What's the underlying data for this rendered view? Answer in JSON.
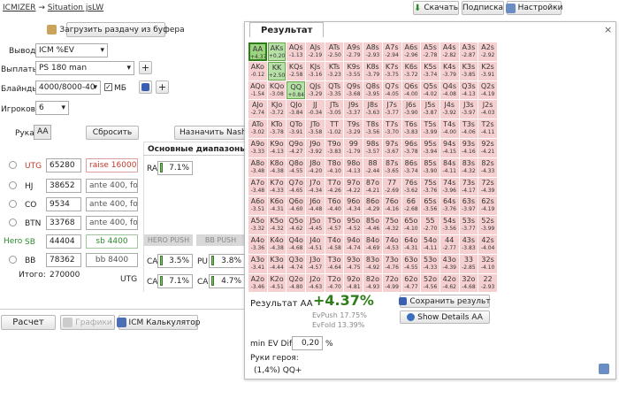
{
  "breadcrumb": {
    "root": "ICMIZER",
    "sep": "→",
    "current": "Situation jsLW"
  },
  "top_buttons": {
    "download": "Скачать",
    "subscribe": "Подписка",
    "settings": "Настройки"
  },
  "left": {
    "load_btn": "Загрузить раздачу из буфера",
    "output_label": "Вывод",
    "output_value": "ICM %EV",
    "payouts_label": "Выплаты",
    "payouts_value": "PS 180 man",
    "blinds_label": "Блайнды",
    "blinds_value": "4000/8000-40",
    "bb_check": "МБ",
    "players_label": "Игроков",
    "players_value": "6",
    "hand_label": "Рука",
    "hand_value": "AA",
    "reset_btn": "Сбросить",
    "assign_btn": "Назначить Nash д",
    "ranges_tab": "Основные диапазоны",
    "ra_label": "RA",
    "ra_value": "7.1%",
    "players": [
      {
        "pos": "UTG",
        "stack": "65280",
        "action": "raise 16000"
      },
      {
        "pos": "HJ",
        "stack": "38652",
        "action": "ante 400, fold"
      },
      {
        "pos": "CO",
        "stack": "9534",
        "action": "ante 400, fold"
      },
      {
        "pos": "BTN",
        "stack": "33768",
        "action": "ante 400, fold"
      },
      {
        "pos": "SB",
        "hero": "Hero",
        "stack": "44404",
        "action": "sb 4400"
      },
      {
        "pos": "BB",
        "stack": "78362",
        "action": "bb 8400"
      }
    ],
    "total_label": "Итого:",
    "total_value": "270000",
    "bottom_pos": "UTG",
    "hero_push": "HERO PUSH",
    "bb_push": "BB PUSH",
    "ca1_label": "CA",
    "ca1_value": "3.5%",
    "pu_label": "PU",
    "pu_value": "3.8%",
    "ca2_label": "CA",
    "ca2_value": "7.1%",
    "ca3_label": "CA",
    "ca3_value": "4.7%"
  },
  "bottom_buttons": {
    "calc": "Расчет",
    "graphs": "Графики",
    "icm": "ICM Калькулятор"
  },
  "result": {
    "tab": "Результат",
    "title": "Результат AA",
    "value": "+4.37%",
    "evpush": "EvPush 17.75%",
    "evfold": "EvFold 13.39%",
    "save_btn": "Сохранить результ",
    "details_btn": "Show Details AA",
    "minev_label": "min EV Diff",
    "minev_value": "0,20",
    "minev_unit": "%",
    "hero_hands_label": "Руки героя:",
    "hero_hands_value": "(1,4%) QQ+"
  },
  "colors": {
    "positive": "#b7e0a6",
    "negative": "#f6d0d0",
    "selected": "#9bd37f",
    "accent": "#2e7d1a"
  },
  "grid": [
    [
      [
        "AA",
        "+4.37",
        "sel"
      ],
      [
        "AKs",
        "+0.20",
        "pos"
      ],
      [
        "AQs",
        "-1.13"
      ],
      [
        "AJs",
        "-2.19"
      ],
      [
        "ATs",
        "-2.50"
      ],
      [
        "A9s",
        "-2.79"
      ],
      [
        "A8s",
        "-2.93"
      ],
      [
        "A7s",
        "-2.94"
      ],
      [
        "A6s",
        "-2.96"
      ],
      [
        "A5s",
        "-2.78"
      ],
      [
        "A4s",
        "-2.82"
      ],
      [
        "A3s",
        "-2.87"
      ],
      [
        "A2s",
        "-2.92"
      ]
    ],
    [
      [
        "AKo",
        "-0.12"
      ],
      [
        "KK",
        "+2.50",
        "pos"
      ],
      [
        "KQs",
        "-2.58"
      ],
      [
        "KJs",
        "-3.16"
      ],
      [
        "KTs",
        "-3.23"
      ],
      [
        "K9s",
        "-3.55"
      ],
      [
        "K8s",
        "-3.79"
      ],
      [
        "K7s",
        "-3.75"
      ],
      [
        "K6s",
        "-3.72"
      ],
      [
        "K5s",
        "-3.74"
      ],
      [
        "K4s",
        "-3.79"
      ],
      [
        "K3s",
        "-3.85"
      ],
      [
        "K2s",
        "-3.91"
      ]
    ],
    [
      [
        "AQo",
        "-1.54"
      ],
      [
        "KQo",
        "-3.08"
      ],
      [
        "QQ",
        "+0.84",
        "pos"
      ],
      [
        "QJs",
        "-3.29"
      ],
      [
        "QTs",
        "-3.35"
      ],
      [
        "Q9s",
        "-3.68"
      ],
      [
        "Q8s",
        "-3.95"
      ],
      [
        "Q7s",
        "-4.05"
      ],
      [
        "Q6s",
        "-4.00"
      ],
      [
        "Q5s",
        "-4.02"
      ],
      [
        "Q4s",
        "-4.08"
      ],
      [
        "Q3s",
        "-4.13"
      ],
      [
        "Q2s",
        "-4.19"
      ]
    ],
    [
      [
        "AJo",
        "-2.74"
      ],
      [
        "KJo",
        "-3.72"
      ],
      [
        "QJo",
        "-3.84"
      ],
      [
        "JJ",
        "-0.34"
      ],
      [
        "JTs",
        "-3.05"
      ],
      [
        "J9s",
        "-3.37"
      ],
      [
        "J8s",
        "-3.63"
      ],
      [
        "J7s",
        "-3.77"
      ],
      [
        "J6s",
        "-3.90"
      ],
      [
        "J5s",
        "-3.87"
      ],
      [
        "J4s",
        "-3.92"
      ],
      [
        "J3s",
        "-3.97"
      ],
      [
        "J2s",
        "-4.03"
      ]
    ],
    [
      [
        "ATo",
        "-3.02"
      ],
      [
        "KTo",
        "-3.78"
      ],
      [
        "QTo",
        "-3.91"
      ],
      [
        "JTo",
        "-3.58"
      ],
      [
        "TT",
        "-1.02"
      ],
      [
        "T9s",
        "-3.29"
      ],
      [
        "T8s",
        "-3.56"
      ],
      [
        "T7s",
        "-3.70"
      ],
      [
        "T6s",
        "-3.83"
      ],
      [
        "T5s",
        "-3.99"
      ],
      [
        "T4s",
        "-4.00"
      ],
      [
        "T3s",
        "-4.06"
      ],
      [
        "T2s",
        "-4.11"
      ]
    ],
    [
      [
        "A9o",
        "-3.33"
      ],
      [
        "K9o",
        "-4.13"
      ],
      [
        "Q9o",
        "-4.27"
      ],
      [
        "J9o",
        "-3.92"
      ],
      [
        "T9o",
        "-3.83"
      ],
      [
        "99",
        "-1.79"
      ],
      [
        "98s",
        "-3.57"
      ],
      [
        "97s",
        "-3.67"
      ],
      [
        "96s",
        "-3.78"
      ],
      [
        "95s",
        "-3.94"
      ],
      [
        "94s",
        "-4.15"
      ],
      [
        "93s",
        "-4.16"
      ],
      [
        "92s",
        "-4.21"
      ]
    ],
    [
      [
        "A8o",
        "-3.48"
      ],
      [
        "K8o",
        "-4.38"
      ],
      [
        "Q8o",
        "-4.55"
      ],
      [
        "J8o",
        "-4.20"
      ],
      [
        "T8o",
        "-4.10"
      ],
      [
        "98o",
        "-4.13"
      ],
      [
        "88",
        "-2.44"
      ],
      [
        "87s",
        "-3.65"
      ],
      [
        "86s",
        "-3.74"
      ],
      [
        "85s",
        "-3.90"
      ],
      [
        "84s",
        "-4.11"
      ],
      [
        "83s",
        "-4.32"
      ],
      [
        "82s",
        "-4.33"
      ]
    ],
    [
      [
        "A7o",
        "-3.48"
      ],
      [
        "K7o",
        "-4.33"
      ],
      [
        "Q7o",
        "-4.65"
      ],
      [
        "J7o",
        "-4.34"
      ],
      [
        "T7o",
        "-4.26"
      ],
      [
        "97o",
        "-4.22"
      ],
      [
        "87o",
        "-4.21"
      ],
      [
        "77",
        "-2.69"
      ],
      [
        "76s",
        "-3.62"
      ],
      [
        "75s",
        "-3.76"
      ],
      [
        "74s",
        "-3.96"
      ],
      [
        "73s",
        "-4.17"
      ],
      [
        "72s",
        "-4.39"
      ]
    ],
    [
      [
        "A6o",
        "-3.51"
      ],
      [
        "K6o",
        "-4.31"
      ],
      [
        "Q6o",
        "-4.60"
      ],
      [
        "J6o",
        "-4.48"
      ],
      [
        "T6o",
        "-4.40"
      ],
      [
        "96o",
        "-4.34"
      ],
      [
        "86o",
        "-4.29"
      ],
      [
        "76o",
        "-4.16"
      ],
      [
        "66",
        "-2.68"
      ],
      [
        "65s",
        "-3.56"
      ],
      [
        "64s",
        "-3.76"
      ],
      [
        "63s",
        "-3.97"
      ],
      [
        "62s",
        "-4.19"
      ]
    ],
    [
      [
        "A5o",
        "-3.32"
      ],
      [
        "K5o",
        "-4.32"
      ],
      [
        "Q5o",
        "-4.62"
      ],
      [
        "J5o",
        "-4.45"
      ],
      [
        "T5o",
        "-4.57"
      ],
      [
        "95o",
        "-4.52"
      ],
      [
        "85o",
        "-4.46"
      ],
      [
        "75o",
        "-4.32"
      ],
      [
        "65o",
        "-4.10"
      ],
      [
        "55",
        "-2.70"
      ],
      [
        "54s",
        "-3.56"
      ],
      [
        "53s",
        "-3.77"
      ],
      [
        "52s",
        "-3.99"
      ]
    ],
    [
      [
        "A4o",
        "-3.36"
      ],
      [
        "K4o",
        "-4.38"
      ],
      [
        "Q4o",
        "-4.68"
      ],
      [
        "J4o",
        "-4.51"
      ],
      [
        "T4o",
        "-4.58"
      ],
      [
        "94o",
        "-4.74"
      ],
      [
        "84o",
        "-4.69"
      ],
      [
        "74o",
        "-4.53"
      ],
      [
        "64o",
        "-4.31"
      ],
      [
        "54o",
        "-4.11"
      ],
      [
        "44",
        "-2.77"
      ],
      [
        "43s",
        "-3.83"
      ],
      [
        "42s",
        "-4.04"
      ]
    ],
    [
      [
        "A3o",
        "-3.41"
      ],
      [
        "K3o",
        "-4.44"
      ],
      [
        "Q3o",
        "-4.74"
      ],
      [
        "J3o",
        "-4.57"
      ],
      [
        "T3o",
        "-4.64"
      ],
      [
        "93o",
        "-4.75"
      ],
      [
        "83o",
        "-4.92"
      ],
      [
        "73o",
        "-4.76"
      ],
      [
        "63o",
        "-4.55"
      ],
      [
        "53o",
        "-4.33"
      ],
      [
        "43o",
        "-4.39"
      ],
      [
        "33",
        "-2.85"
      ],
      [
        "32s",
        "-4.10"
      ]
    ],
    [
      [
        "A2o",
        "-3.46"
      ],
      [
        "K2o",
        "-4.51"
      ],
      [
        "Q2o",
        "-4.80"
      ],
      [
        "J2o",
        "-4.63"
      ],
      [
        "T2o",
        "-4.70"
      ],
      [
        "92o",
        "-4.81"
      ],
      [
        "82o",
        "-4.93"
      ],
      [
        "72o",
        "-4.99"
      ],
      [
        "62o",
        "-4.77"
      ],
      [
        "52o",
        "-4.56"
      ],
      [
        "42o",
        "-4.62"
      ],
      [
        "32o",
        "-4.68"
      ],
      [
        "22",
        "-2.93"
      ]
    ]
  ]
}
